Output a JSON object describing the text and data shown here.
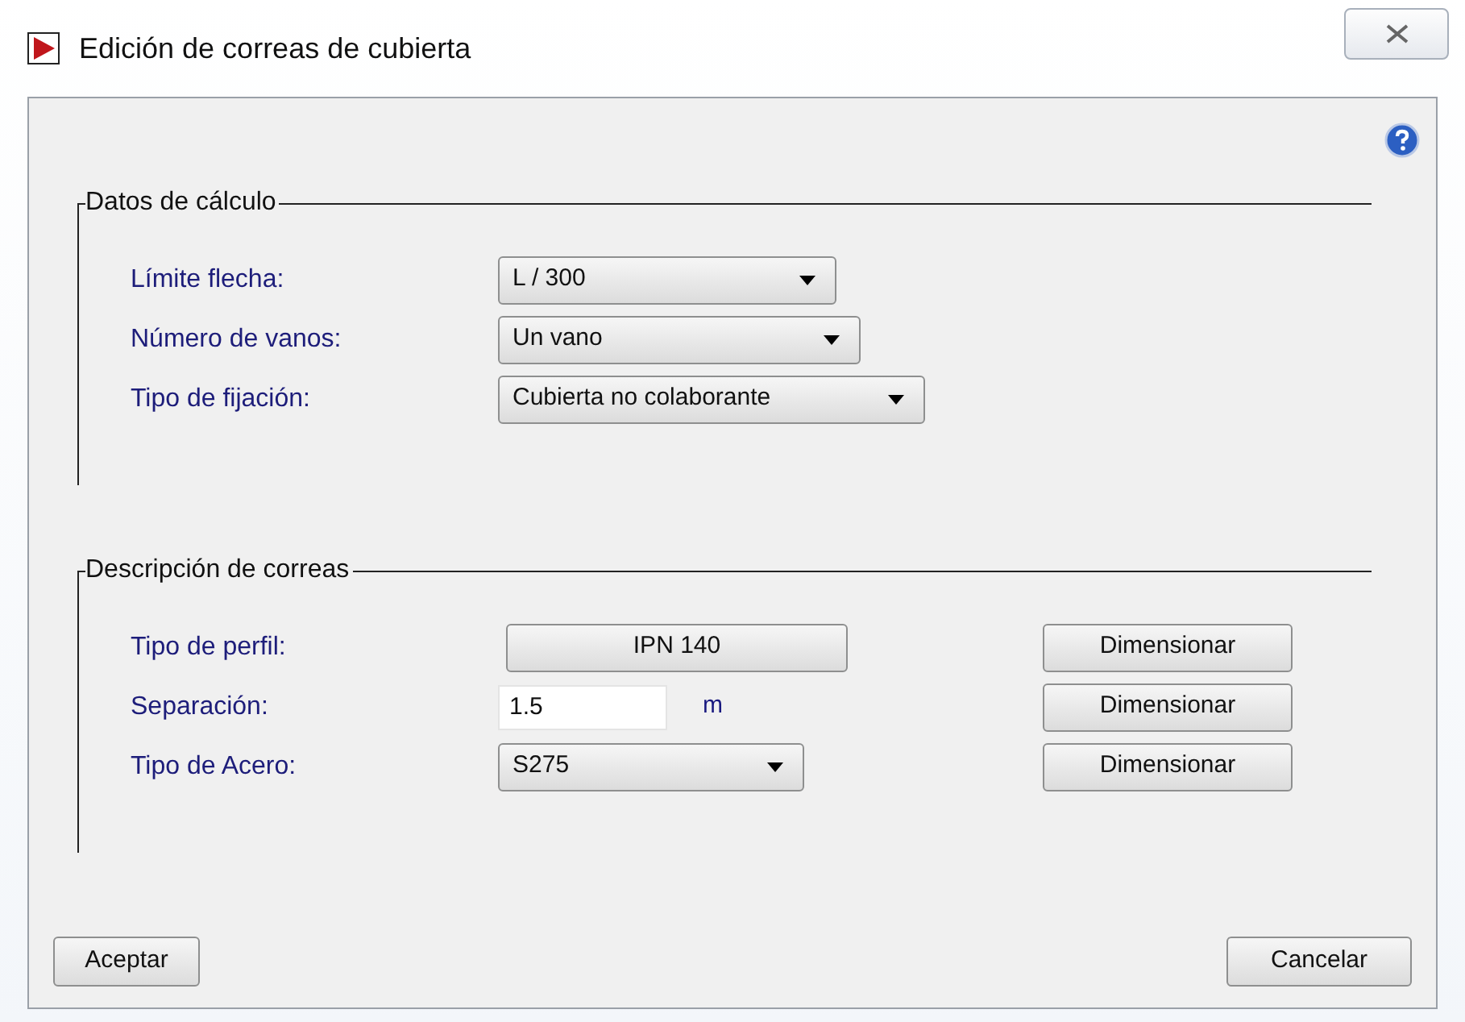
{
  "window": {
    "title": "Edición de correas de cubierta"
  },
  "groups": [
    {
      "title": "Datos de cálculo",
      "rows": [
        {
          "kind": "combo",
          "label": "Límite flecha:",
          "value": "L / 300"
        },
        {
          "kind": "combo",
          "label": "Número de vanos:",
          "value": "Un vano"
        },
        {
          "kind": "combo",
          "label": "Tipo de fijación:",
          "value": "Cubierta no colaborante"
        }
      ]
    },
    {
      "title": "Descripción de correas",
      "rows": [
        {
          "kind": "button",
          "label": "Tipo de perfil:",
          "value": "IPN 140",
          "action": "Dimensionar"
        },
        {
          "kind": "input",
          "label": "Separación:",
          "value": "1.5",
          "unit": "m",
          "action": "Dimensionar"
        },
        {
          "kind": "combo",
          "label": "Tipo de Acero:",
          "value": "S275",
          "action": "Dimensionar"
        }
      ]
    }
  ],
  "buttons": {
    "accept": "Aceptar",
    "cancel": "Cancelar"
  }
}
